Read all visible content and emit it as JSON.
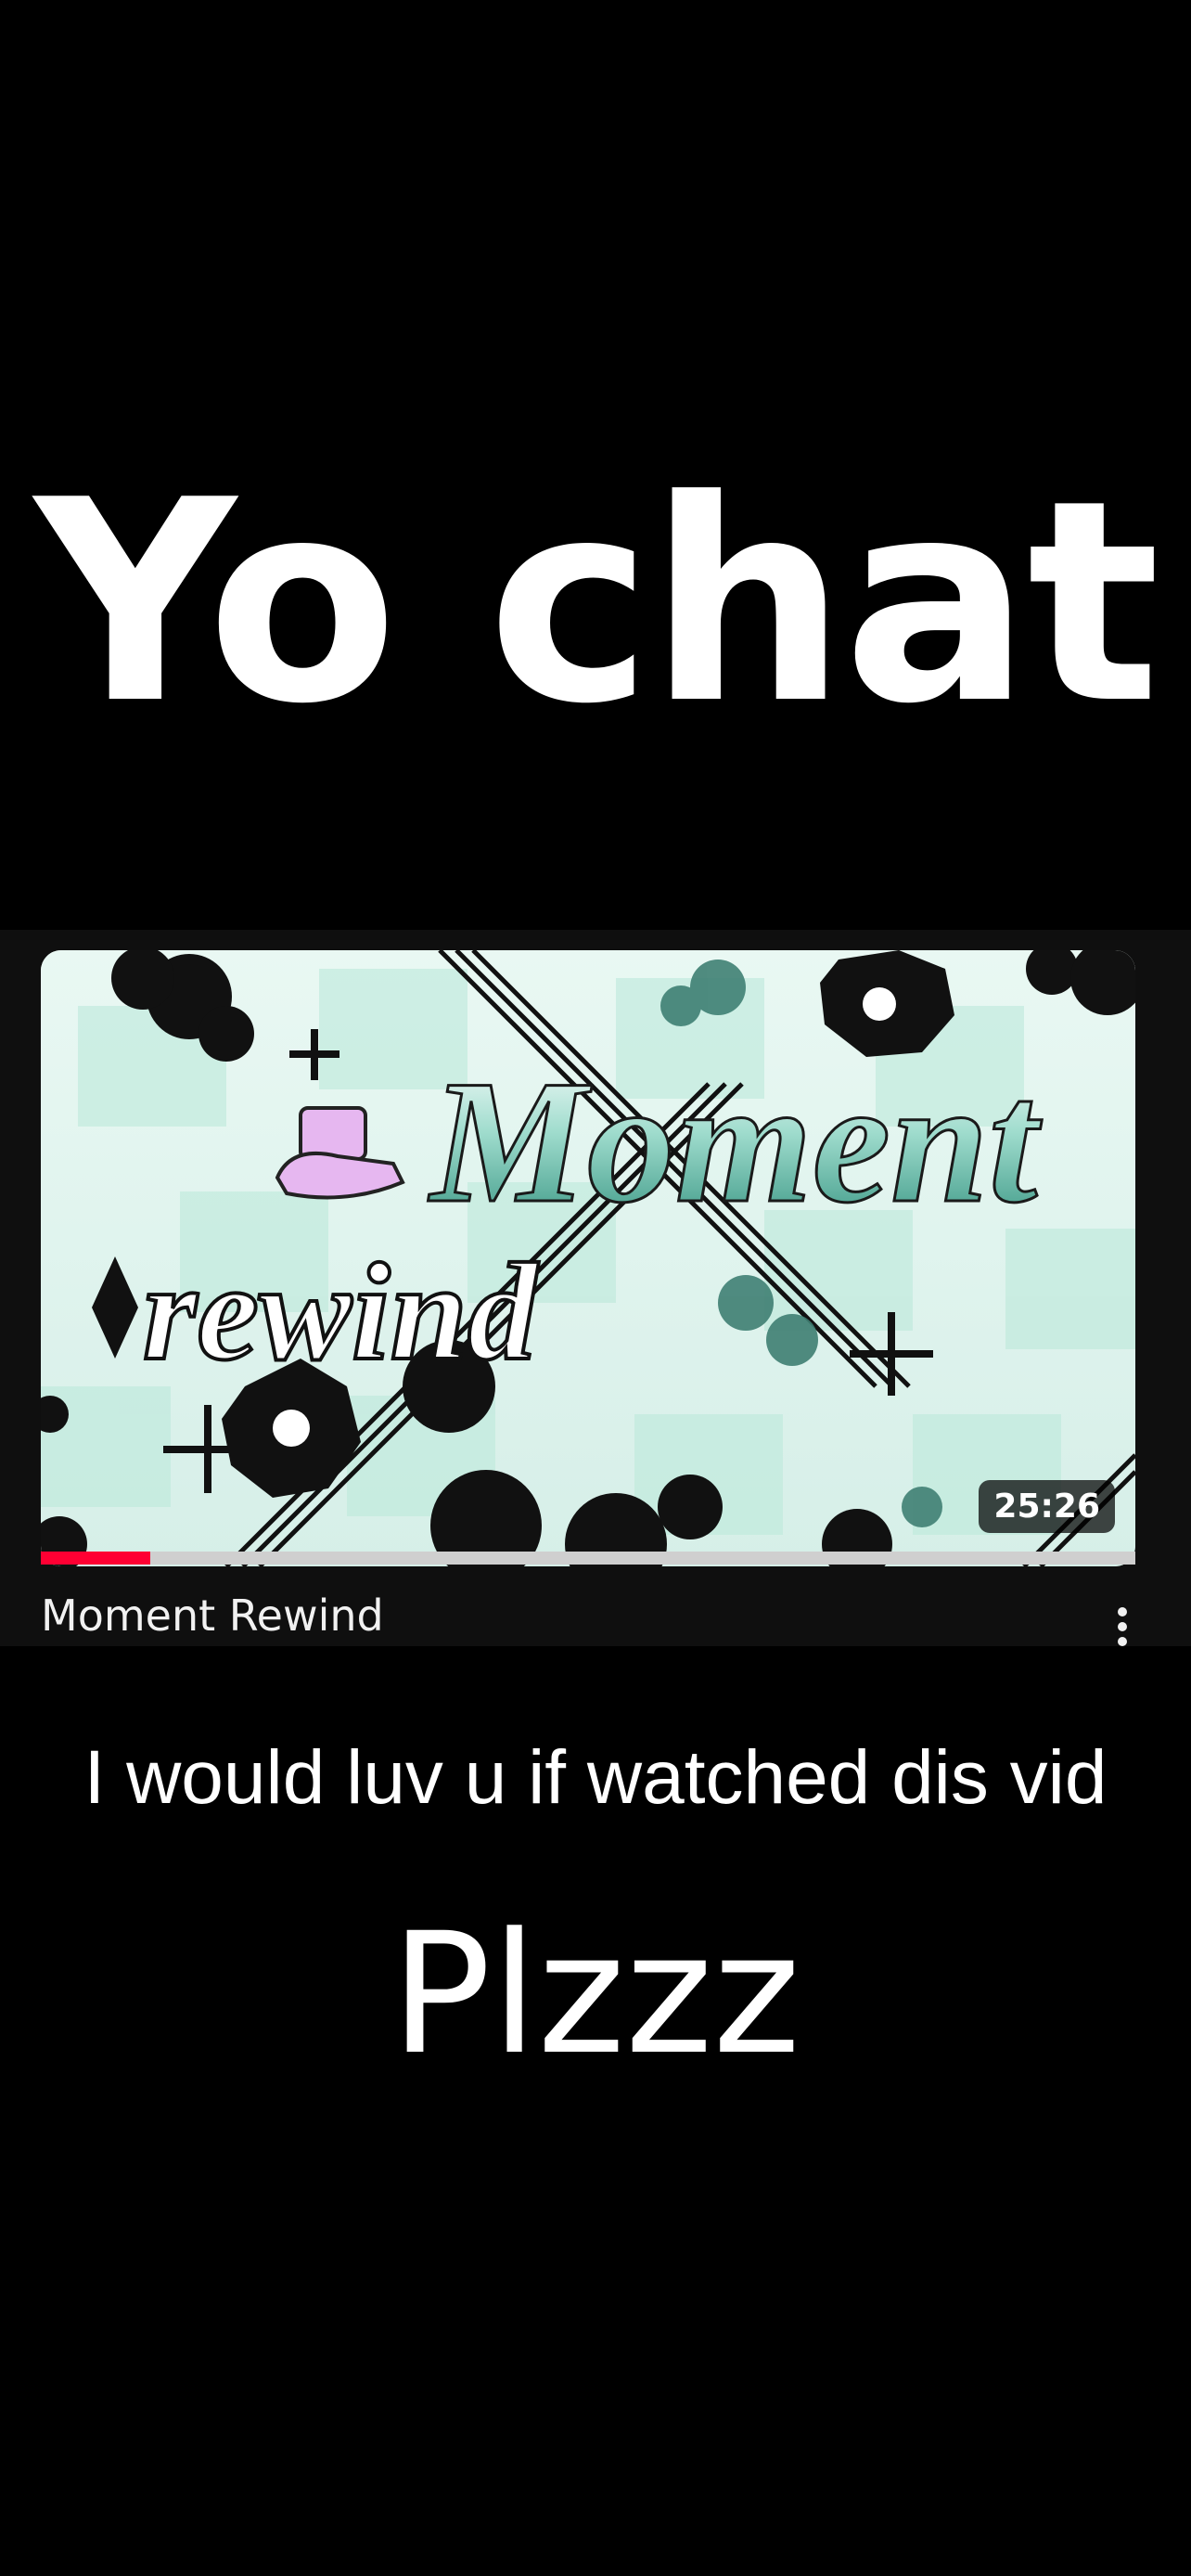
{
  "overlay": {
    "headline": "Yo chat",
    "caption": "I would luv u if watched dis vid",
    "plea": "Plzzz"
  },
  "video": {
    "title": "Moment Rewind",
    "duration": "25:26",
    "thumbnail_text_line1": "Moment",
    "thumbnail_text_line2": "rewind",
    "watched_progress_percent": 10
  },
  "colors": {
    "background": "#000000",
    "card_background": "#0f0f0f",
    "progress_red": "#ff0033",
    "thumbnail_mint": "#bfe9dc"
  },
  "icons": {
    "more": "more-vertical-icon"
  }
}
